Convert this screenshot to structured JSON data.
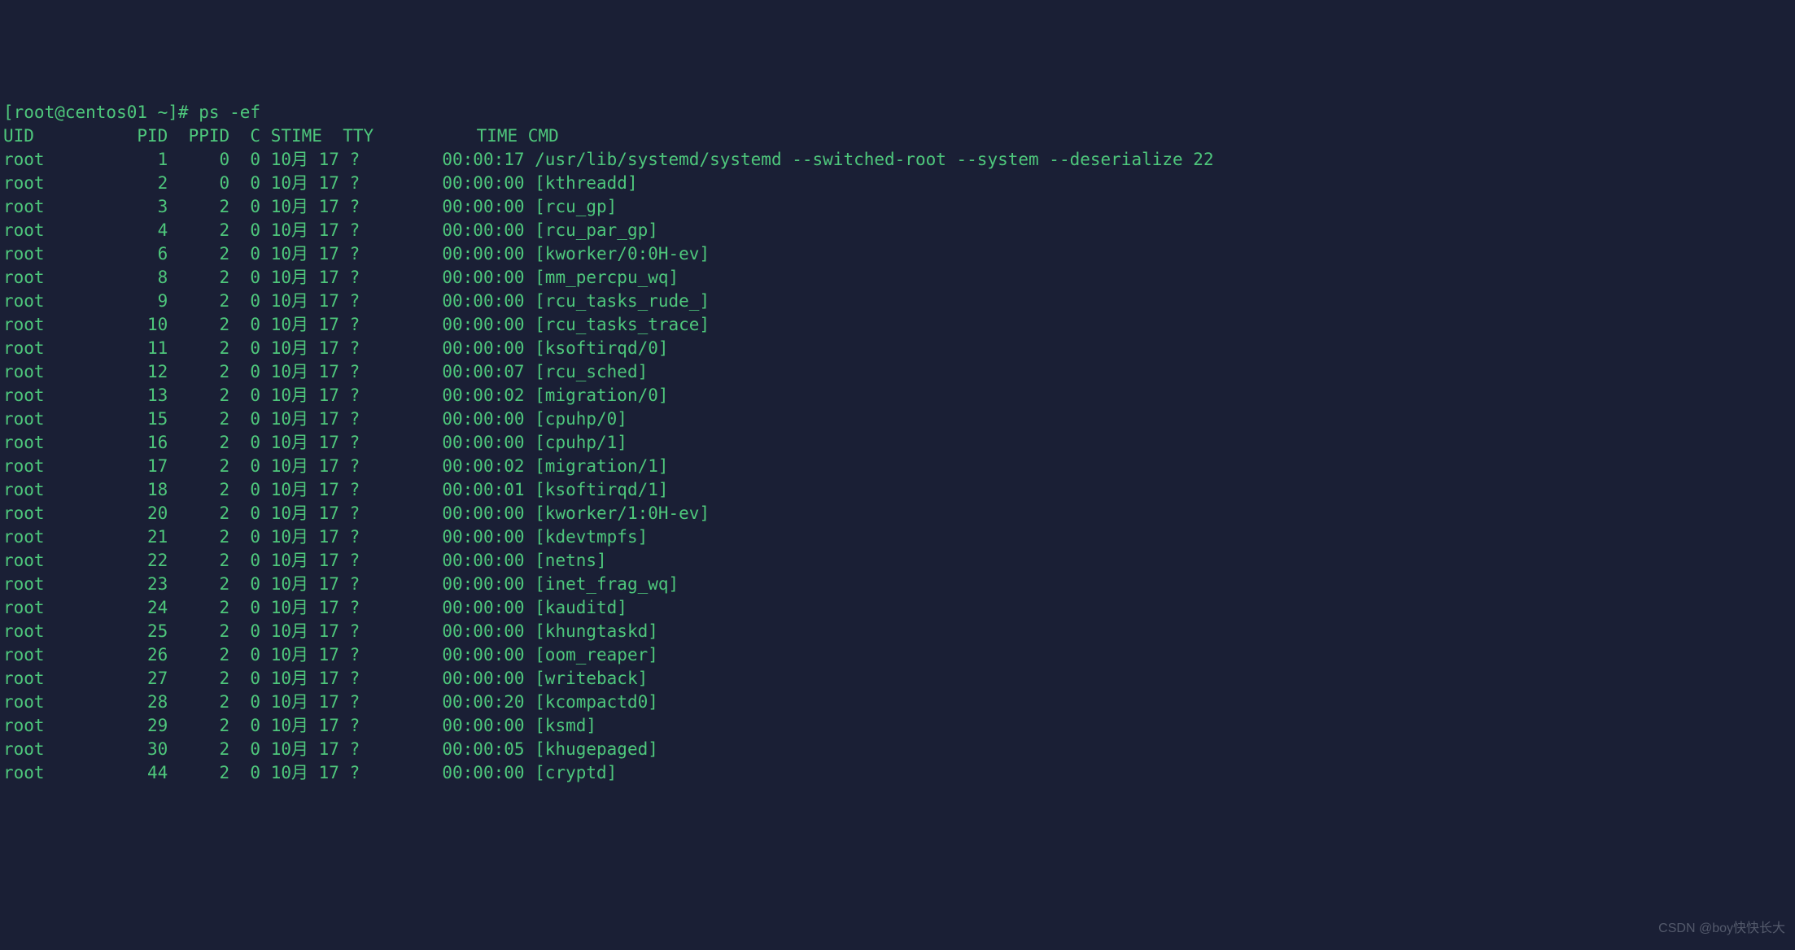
{
  "prompt": "[root@centos01 ~]# ps -ef",
  "headers": {
    "UID": "UID",
    "PID": "PID",
    "PPID": "PPID",
    "C": "C",
    "STIME": "STIME",
    "TTY": "TTY",
    "TIME": "TIME",
    "CMD": "CMD"
  },
  "rows": [
    {
      "uid": "root",
      "pid": "1",
      "ppid": "0",
      "c": "0",
      "stime": "10月 17",
      "tty": "?",
      "time": "00:00:17",
      "cmd": "/usr/lib/systemd/systemd --switched-root --system --deserialize 22"
    },
    {
      "uid": "root",
      "pid": "2",
      "ppid": "0",
      "c": "0",
      "stime": "10月 17",
      "tty": "?",
      "time": "00:00:00",
      "cmd": "[kthreadd]"
    },
    {
      "uid": "root",
      "pid": "3",
      "ppid": "2",
      "c": "0",
      "stime": "10月 17",
      "tty": "?",
      "time": "00:00:00",
      "cmd": "[rcu_gp]"
    },
    {
      "uid": "root",
      "pid": "4",
      "ppid": "2",
      "c": "0",
      "stime": "10月 17",
      "tty": "?",
      "time": "00:00:00",
      "cmd": "[rcu_par_gp]"
    },
    {
      "uid": "root",
      "pid": "6",
      "ppid": "2",
      "c": "0",
      "stime": "10月 17",
      "tty": "?",
      "time": "00:00:00",
      "cmd": "[kworker/0:0H-ev]"
    },
    {
      "uid": "root",
      "pid": "8",
      "ppid": "2",
      "c": "0",
      "stime": "10月 17",
      "tty": "?",
      "time": "00:00:00",
      "cmd": "[mm_percpu_wq]"
    },
    {
      "uid": "root",
      "pid": "9",
      "ppid": "2",
      "c": "0",
      "stime": "10月 17",
      "tty": "?",
      "time": "00:00:00",
      "cmd": "[rcu_tasks_rude_]"
    },
    {
      "uid": "root",
      "pid": "10",
      "ppid": "2",
      "c": "0",
      "stime": "10月 17",
      "tty": "?",
      "time": "00:00:00",
      "cmd": "[rcu_tasks_trace]"
    },
    {
      "uid": "root",
      "pid": "11",
      "ppid": "2",
      "c": "0",
      "stime": "10月 17",
      "tty": "?",
      "time": "00:00:00",
      "cmd": "[ksoftirqd/0]"
    },
    {
      "uid": "root",
      "pid": "12",
      "ppid": "2",
      "c": "0",
      "stime": "10月 17",
      "tty": "?",
      "time": "00:00:07",
      "cmd": "[rcu_sched]"
    },
    {
      "uid": "root",
      "pid": "13",
      "ppid": "2",
      "c": "0",
      "stime": "10月 17",
      "tty": "?",
      "time": "00:00:02",
      "cmd": "[migration/0]"
    },
    {
      "uid": "root",
      "pid": "15",
      "ppid": "2",
      "c": "0",
      "stime": "10月 17",
      "tty": "?",
      "time": "00:00:00",
      "cmd": "[cpuhp/0]"
    },
    {
      "uid": "root",
      "pid": "16",
      "ppid": "2",
      "c": "0",
      "stime": "10月 17",
      "tty": "?",
      "time": "00:00:00",
      "cmd": "[cpuhp/1]"
    },
    {
      "uid": "root",
      "pid": "17",
      "ppid": "2",
      "c": "0",
      "stime": "10月 17",
      "tty": "?",
      "time": "00:00:02",
      "cmd": "[migration/1]"
    },
    {
      "uid": "root",
      "pid": "18",
      "ppid": "2",
      "c": "0",
      "stime": "10月 17",
      "tty": "?",
      "time": "00:00:01",
      "cmd": "[ksoftirqd/1]"
    },
    {
      "uid": "root",
      "pid": "20",
      "ppid": "2",
      "c": "0",
      "stime": "10月 17",
      "tty": "?",
      "time": "00:00:00",
      "cmd": "[kworker/1:0H-ev]"
    },
    {
      "uid": "root",
      "pid": "21",
      "ppid": "2",
      "c": "0",
      "stime": "10月 17",
      "tty": "?",
      "time": "00:00:00",
      "cmd": "[kdevtmpfs]"
    },
    {
      "uid": "root",
      "pid": "22",
      "ppid": "2",
      "c": "0",
      "stime": "10月 17",
      "tty": "?",
      "time": "00:00:00",
      "cmd": "[netns]"
    },
    {
      "uid": "root",
      "pid": "23",
      "ppid": "2",
      "c": "0",
      "stime": "10月 17",
      "tty": "?",
      "time": "00:00:00",
      "cmd": "[inet_frag_wq]"
    },
    {
      "uid": "root",
      "pid": "24",
      "ppid": "2",
      "c": "0",
      "stime": "10月 17",
      "tty": "?",
      "time": "00:00:00",
      "cmd": "[kauditd]"
    },
    {
      "uid": "root",
      "pid": "25",
      "ppid": "2",
      "c": "0",
      "stime": "10月 17",
      "tty": "?",
      "time": "00:00:00",
      "cmd": "[khungtaskd]"
    },
    {
      "uid": "root",
      "pid": "26",
      "ppid": "2",
      "c": "0",
      "stime": "10月 17",
      "tty": "?",
      "time": "00:00:00",
      "cmd": "[oom_reaper]"
    },
    {
      "uid": "root",
      "pid": "27",
      "ppid": "2",
      "c": "0",
      "stime": "10月 17",
      "tty": "?",
      "time": "00:00:00",
      "cmd": "[writeback]"
    },
    {
      "uid": "root",
      "pid": "28",
      "ppid": "2",
      "c": "0",
      "stime": "10月 17",
      "tty": "?",
      "time": "00:00:20",
      "cmd": "[kcompactd0]"
    },
    {
      "uid": "root",
      "pid": "29",
      "ppid": "2",
      "c": "0",
      "stime": "10月 17",
      "tty": "?",
      "time": "00:00:00",
      "cmd": "[ksmd]"
    },
    {
      "uid": "root",
      "pid": "30",
      "ppid": "2",
      "c": "0",
      "stime": "10月 17",
      "tty": "?",
      "time": "00:00:05",
      "cmd": "[khugepaged]"
    },
    {
      "uid": "root",
      "pid": "44",
      "ppid": "2",
      "c": "0",
      "stime": "10月 17",
      "tty": "?",
      "time": "00:00:00",
      "cmd": "[cryptd]"
    }
  ],
  "watermark": "CSDN @boy快快长大"
}
